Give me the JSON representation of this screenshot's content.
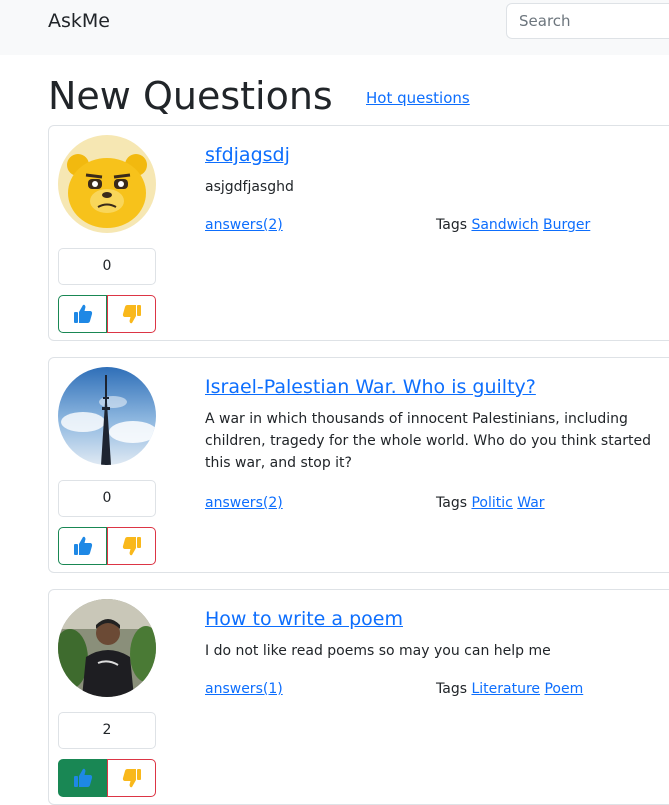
{
  "navbar": {
    "brand": "AskMe",
    "search_placeholder": "Search"
  },
  "page": {
    "title": "New Questions",
    "hot_link": "Hot questions"
  },
  "icons": {
    "like": "thumbs-up-icon",
    "dislike": "thumbs-down-icon"
  },
  "colors": {
    "link": "#0d6efd",
    "like": "#198754",
    "dislike": "#dc3545",
    "thumb_up": "#1e88e5",
    "thumb_down": "#f9b81b"
  },
  "questions": [
    {
      "title": "sfdjagsdj",
      "text": "asjgdfjasghd",
      "answers": "answers(2)",
      "tags_label": "Tags",
      "tags": [
        "Sandwich",
        "Burger"
      ],
      "rating": "0",
      "liked": false
    },
    {
      "title": "Israel-Palestian War. Who is guilty?",
      "text": "A war in which thousands of innocent Palestinians, including children, tragedy for the whole world. Who do you think started this war, and stop it?",
      "answers": "answers(2)",
      "tags_label": "Tags",
      "tags": [
        "Politic",
        "War"
      ],
      "rating": "0",
      "liked": false
    },
    {
      "title": "How to write a poem",
      "text": "I do not like read poems so may you can help me",
      "answers": "answers(1)",
      "tags_label": "Tags",
      "tags": [
        "Literature",
        "Poem"
      ],
      "rating": "2",
      "liked": true
    }
  ]
}
